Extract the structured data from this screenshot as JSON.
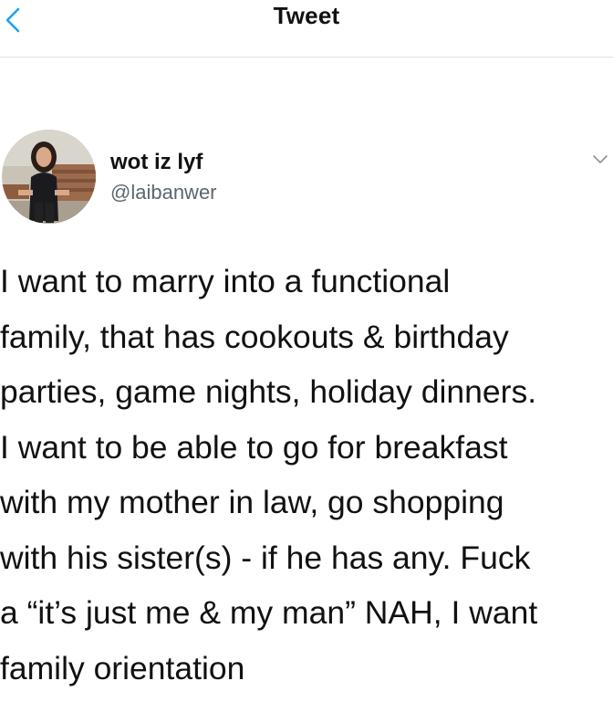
{
  "header": {
    "title": "Tweet",
    "back_icon": "chevron-left-icon",
    "accent": "#1da1f2"
  },
  "author": {
    "name": "wot iz lyf",
    "handle": "@laibanwer",
    "more_icon": "chevron-down-icon"
  },
  "tweet": {
    "text": "I want to marry into a functional\nfamily, that has cookouts & birthday\nparties, game nights, holiday dinners.\nI want to be able to go for breakfast\nwith my mother in law, go shopping\nwith his sister(s) - if he has any. Fuck\na “it’s just me & my man” NAH, I want\nfamily orientation"
  }
}
